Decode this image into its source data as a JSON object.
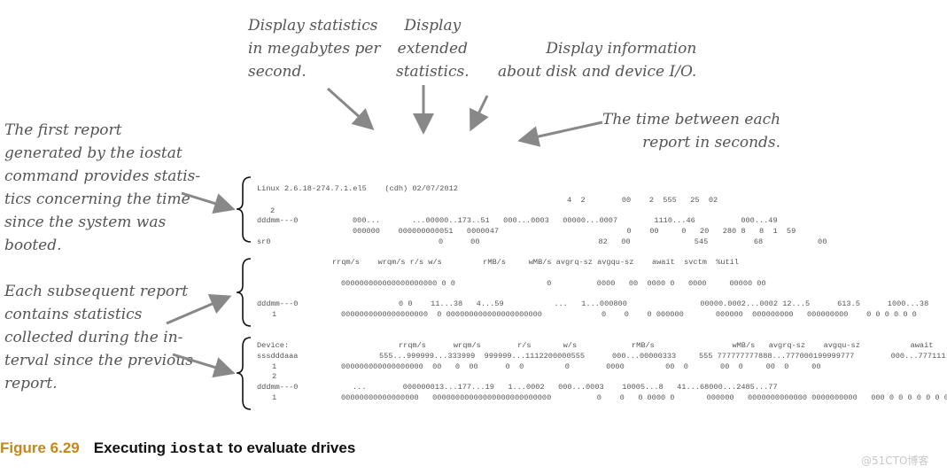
{
  "annotations": {
    "megabytes": "Display statistics\nin megabytes per\nsecond.",
    "extended": "Display\nextended\nstatistics.",
    "device_io": "Display information\nabout disk and device I/O.",
    "interval": "The time between each\nreport in seconds.",
    "first_report": "The first report\ngenerated by the iostat\ncommand provides statis-\ntics concerning the time\nsince the system was\nbooted.",
    "subsequent": "Each subsequent report\ncontains statistics\ncollected during the in-\nterval since the previous\nreport."
  },
  "terminal": {
    "b1": [
      "Linux 2.6.18-274.7.1.el5    (cdh) 02/07/2012",
      "4  2        00    2  555   25  02",
      "2",
      "dddmm---0",
      "000...       ...00000..173..51   000...0003   00000...0007        1110...46          000...49",
      "000000    000000000051   0000047                            0    00     0   20   280 8   8  1  59",
      "sr0",
      "0      00                          82   00              545          68            00"
    ],
    "b2": [
      "rrqm/s    wrqm/s r/s w/s         rMB/s     wMB/s avgrq-sz avgqu-sz    await  svctm  %util",
      "000000000000000000000 0 0                    0          0000   00  0000 0   0000     00000 00",
      "dddmm---0",
      "0 0    11...38   4...59           ...   1...000800                00000.0002...0002 12...5      613.5      1000...38",
      "1",
      "0000000000000000000  0 000000000000000000000             0    0    0 000000       000000  000000000   000000000    0 0 0 0 0 0"
    ],
    "b3": [
      "Device:",
      "rrqm/s      wrqm/s        r/s       w/s            rMB/s                 wMB/s   avgrq-sz    avgqu-sz           await       svctm",
      "sssdddaaa",
      "555...999999...333999  999999...1112200000555      000...00000333     555 777777777888...777000199999777        000...777111",
      "1",
      "000000000000000000  00   0  00      0  0         0        0000         00  0       00  0     00  0     00",
      "2",
      "dddmm---0",
      "...        000000013...177...19   1...0002   000...0003    10005...8   41...68000...2485...77",
      "1",
      "00000000000000000   00000000000000000000000000          0    0   0 0000 0       000000   0000000000000 0000000000   000 0 0 0 0 0 0 0"
    ]
  },
  "caption": {
    "figure": "Figure 6.29",
    "text_before": "Executing ",
    "command": "iostat",
    "text_after": " to evaluate drives"
  },
  "watermark": "@51CTO博客",
  "colors": {
    "figure_label": "#c8861a",
    "annotation": "#555555"
  }
}
